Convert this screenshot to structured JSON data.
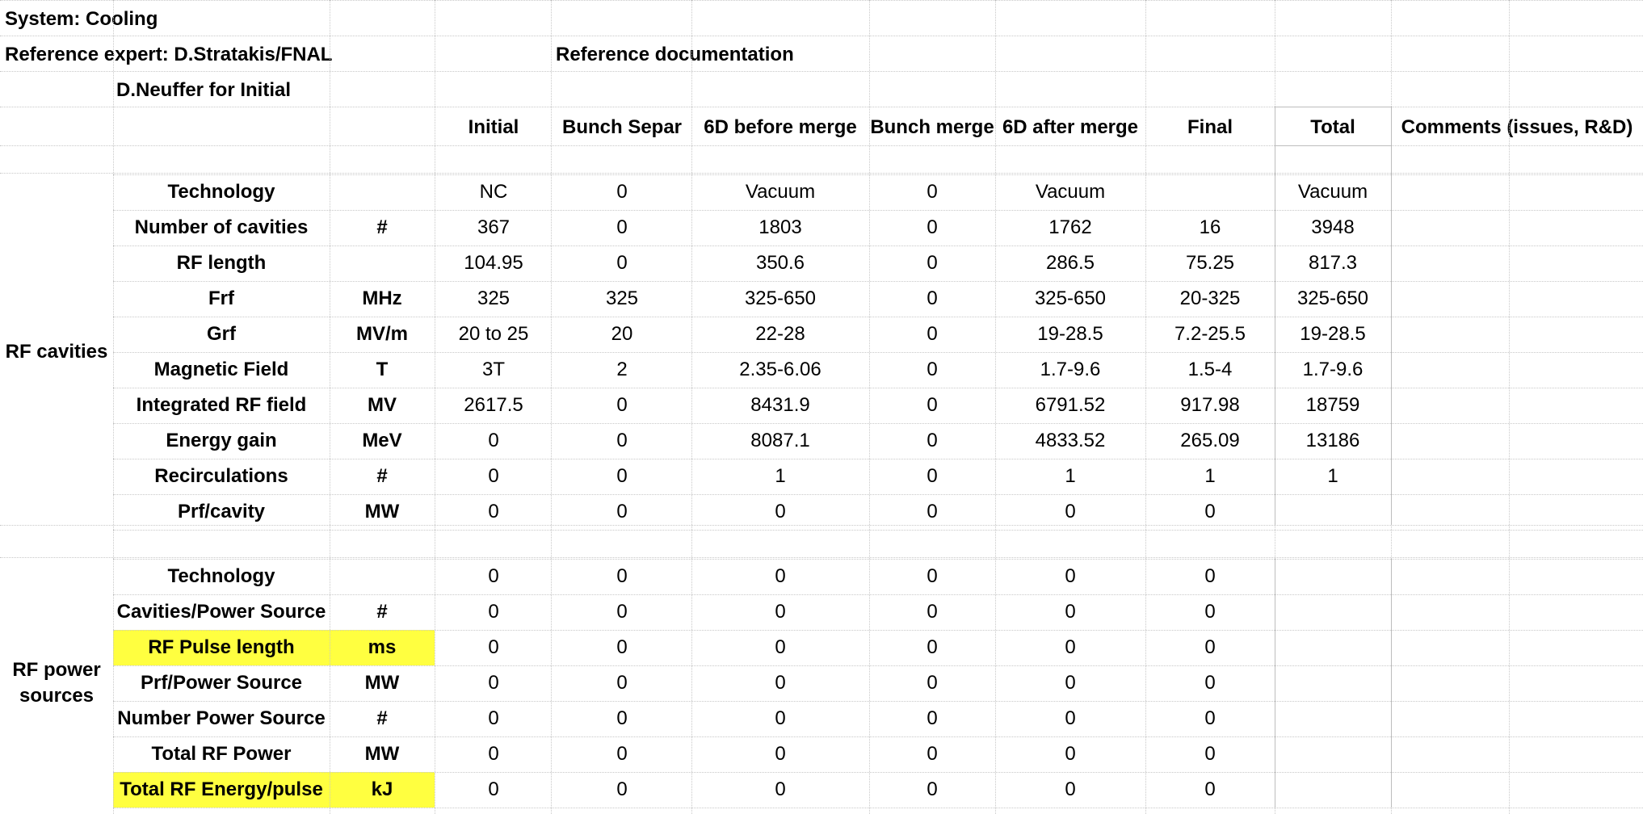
{
  "header": {
    "system": "System: Cooling",
    "expert": "Reference expert: D.Stratakis/FNAL",
    "expert2": "D.Neuffer for Initial",
    "refdoc": "Reference documentation"
  },
  "columns": [
    "Initial",
    "Bunch Separ",
    "6D before merge",
    "Bunch merge",
    "6D after merge",
    "Final",
    "Total",
    "Comments (issues, R&D)"
  ],
  "sections": [
    {
      "name": "RF cavities",
      "rows": [
        {
          "param": "Technology",
          "unit": "",
          "values": [
            "NC",
            "0",
            "Vacuum",
            "0",
            "Vacuum",
            "",
            "Vacuum"
          ],
          "highlight": false
        },
        {
          "param": "Number of cavities",
          "unit": "#",
          "values": [
            "367",
            "0",
            "1803",
            "0",
            "1762",
            "16",
            "3948"
          ],
          "highlight": false
        },
        {
          "param": "RF length",
          "unit": "",
          "values": [
            "104.95",
            "0",
            "350.6",
            "0",
            "286.5",
            "75.25",
            "817.3"
          ],
          "highlight": false
        },
        {
          "param": "Frf",
          "unit": "MHz",
          "values": [
            "325",
            "325",
            "325-650",
            "0",
            "325-650",
            "20-325",
            "325-650"
          ],
          "highlight": false
        },
        {
          "param": "Grf",
          "unit": "MV/m",
          "values": [
            "20 to 25",
            "20",
            "22-28",
            "0",
            "19-28.5",
            "7.2-25.5",
            "19-28.5"
          ],
          "highlight": false
        },
        {
          "param": "Magnetic Field",
          "unit": "T",
          "values": [
            "3T",
            "2",
            "2.35-6.06",
            "0",
            "1.7-9.6",
            "1.5-4",
            "1.7-9.6"
          ],
          "highlight": false
        },
        {
          "param": "Integrated RF field",
          "unit": "MV",
          "values": [
            "2617.5",
            "0",
            "8431.9",
            "0",
            "6791.52",
            "917.98",
            "18759"
          ],
          "highlight": false
        },
        {
          "param": "Energy gain",
          "unit": "MeV",
          "values": [
            "0",
            "0",
            "8087.1",
            "0",
            "4833.52",
            "265.09",
            "13186"
          ],
          "highlight": false
        },
        {
          "param": "Recirculations",
          "unit": "#",
          "values": [
            "0",
            "0",
            "1",
            "0",
            "1",
            "1",
            "1"
          ],
          "highlight": false
        },
        {
          "param": "Prf/cavity",
          "unit": "MW",
          "values": [
            "0",
            "0",
            "0",
            "0",
            "0",
            "0",
            ""
          ],
          "highlight": false
        }
      ]
    },
    {
      "name": "RF power sources",
      "rows": [
        {
          "param": "Technology",
          "unit": "",
          "values": [
            "0",
            "0",
            "0",
            "0",
            "0",
            "0",
            ""
          ],
          "highlight": false
        },
        {
          "param": "Cavities/Power Source",
          "unit": "#",
          "values": [
            "0",
            "0",
            "0",
            "0",
            "0",
            "0",
            ""
          ],
          "highlight": false
        },
        {
          "param": "RF Pulse length",
          "unit": "ms",
          "values": [
            "0",
            "0",
            "0",
            "0",
            "0",
            "0",
            ""
          ],
          "highlight": true
        },
        {
          "param": "Prf/Power Source",
          "unit": "MW",
          "values": [
            "0",
            "0",
            "0",
            "0",
            "0",
            "0",
            ""
          ],
          "highlight": false
        },
        {
          "param": "Number Power Source",
          "unit": "#",
          "values": [
            "0",
            "0",
            "0",
            "0",
            "0",
            "0",
            ""
          ],
          "highlight": false
        },
        {
          "param": "Total RF Power",
          "unit": "MW",
          "values": [
            "0",
            "0",
            "0",
            "0",
            "0",
            "0",
            ""
          ],
          "highlight": false
        },
        {
          "param": "Total RF Energy/pulse",
          "unit": "kJ",
          "values": [
            "0",
            "0",
            "0",
            "0",
            "0",
            "0",
            ""
          ],
          "highlight": true
        }
      ]
    }
  ],
  "colors": {
    "highlight": "#ffff40",
    "grid": "#c8c8c8"
  }
}
